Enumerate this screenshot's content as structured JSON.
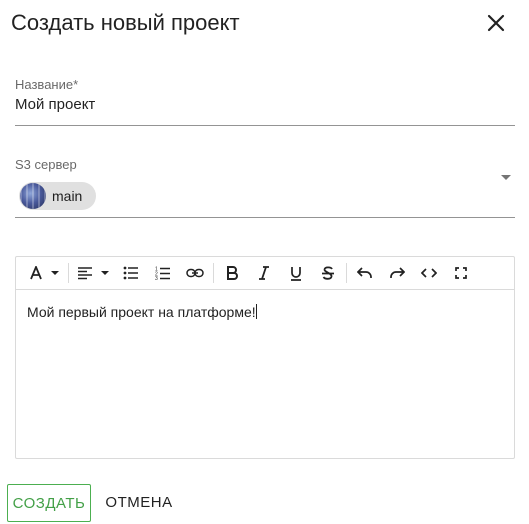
{
  "dialog": {
    "title": "Создать новый проект"
  },
  "form": {
    "name_field": {
      "label": "Название*",
      "value": "Мой проект"
    },
    "s3_field": {
      "label": "S3 сервер",
      "selected_chip": "main"
    }
  },
  "editor": {
    "toolbar": [
      "text-color",
      "align",
      "bulleted-list",
      "numbered-list",
      "link",
      "bold",
      "italic",
      "underline",
      "strikethrough",
      "undo",
      "redo",
      "code-view",
      "fullscreen"
    ],
    "content": "Мой первый проект на платформе!"
  },
  "actions": {
    "create_label": "Создать",
    "cancel_label": "Отмена"
  },
  "colors": {
    "accent_green": "#43a047",
    "chip_bg": "#e0e0e0"
  }
}
